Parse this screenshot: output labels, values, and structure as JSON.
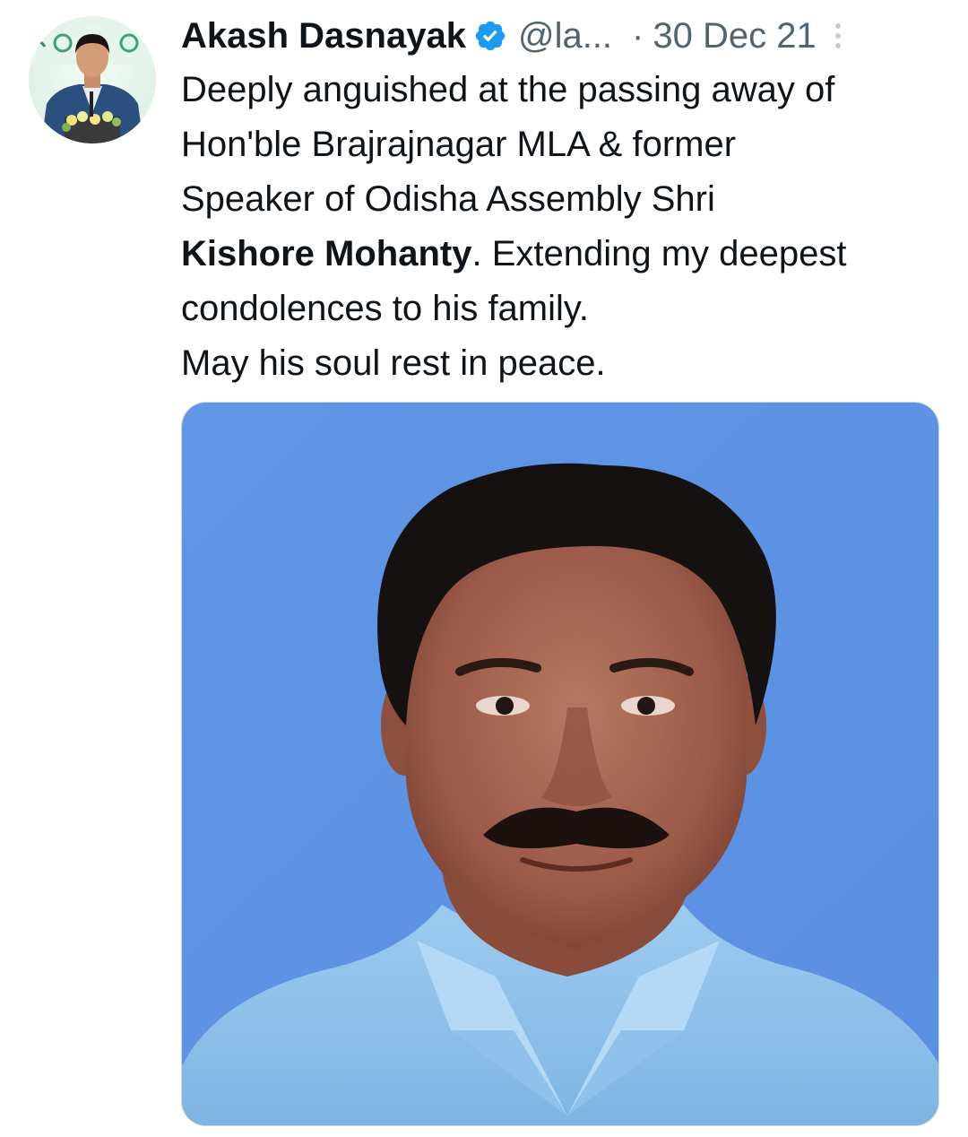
{
  "tweet": {
    "display_name": "Akash Dasnayak",
    "handle": "@la...",
    "separator": "·",
    "date": "30 Dec 21",
    "body": {
      "line1": "Deeply anguished at the passing away of",
      "line2": "Hon'ble Brajrajnagar MLA & former",
      "line3": "Speaker of Odisha Assembly Shri",
      "line4_bold": "Kishore Mohanty",
      "line4_rest": ". Extending my deepest",
      "line5": "condolences to his family.",
      "line6": "May his soul rest in peace."
    }
  },
  "icons": {
    "verified": "verified-badge-icon",
    "more": "more-options-icon"
  },
  "colors": {
    "verified_blue": "#1d9bf0",
    "secondary_text": "#536471",
    "photo_background": "#5e92e6",
    "shirt": "#8cc0e8"
  }
}
